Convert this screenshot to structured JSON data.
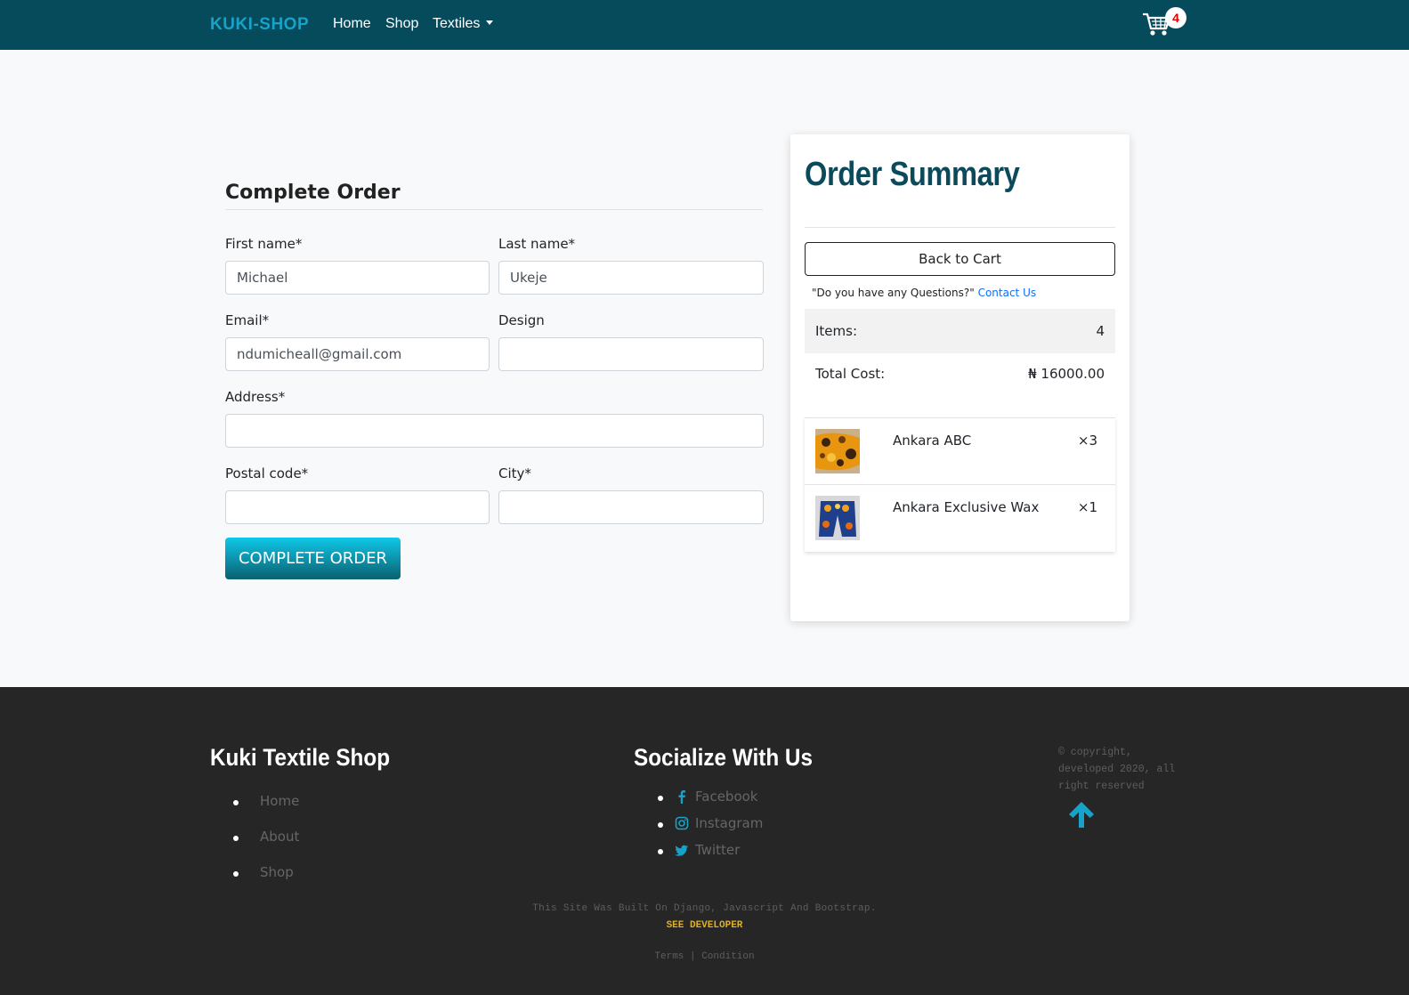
{
  "navbar": {
    "brand": "KUKI-SHOP",
    "links": {
      "home": "Home",
      "shop": "Shop",
      "textiles": "Textiles"
    },
    "cart_count": "4",
    "bg_color": "#064b5c",
    "brand_color": "#17a2c9"
  },
  "form": {
    "title": "Complete Order",
    "fields": {
      "first_name": {
        "label": "First name*",
        "value": "Michael"
      },
      "last_name": {
        "label": "Last name*",
        "value": "Ukeje"
      },
      "email": {
        "label": "Email*",
        "value": "ndumicheall@gmail.com"
      },
      "design": {
        "label": "Design",
        "value": ""
      },
      "address": {
        "label": "Address*",
        "value": ""
      },
      "postal_code": {
        "label": "Postal code*",
        "value": ""
      },
      "city": {
        "label": "City*",
        "value": ""
      }
    },
    "submit_label": "COMPLETE ORDER"
  },
  "summary": {
    "title": "Order Summary",
    "back_label": "Back to Cart",
    "question_text": "\"Do you have any Questions?\"",
    "contact_label": "Contact Us",
    "items_label": "Items:",
    "items_value": "4",
    "total_label": "Total Cost:",
    "total_value": "₦ 16000.00",
    "cart_items": [
      {
        "name": "Ankara ABC",
        "qty": "×3"
      },
      {
        "name": "Ankara Exclusive Wax",
        "qty": "×1"
      }
    ]
  },
  "footer": {
    "shop_heading": "Kuki Textile Shop",
    "shop_links": [
      "Home",
      "About",
      "Shop"
    ],
    "social_heading": "Socialize With Us",
    "social_links": [
      {
        "label": "Facebook",
        "icon": "facebook-icon"
      },
      {
        "label": "Instagram",
        "icon": "instagram-icon"
      },
      {
        "label": "Twitter",
        "icon": "twitter-icon"
      }
    ],
    "copyright": "© copyright, developed 2020, all right reserved",
    "built_with": "This Site Was Built On Django, Javascript And Bootstrap.",
    "see_developer": "SEE DEVELOPER",
    "terms": "Terms | Condition",
    "accent_color": "#17a2c9"
  }
}
